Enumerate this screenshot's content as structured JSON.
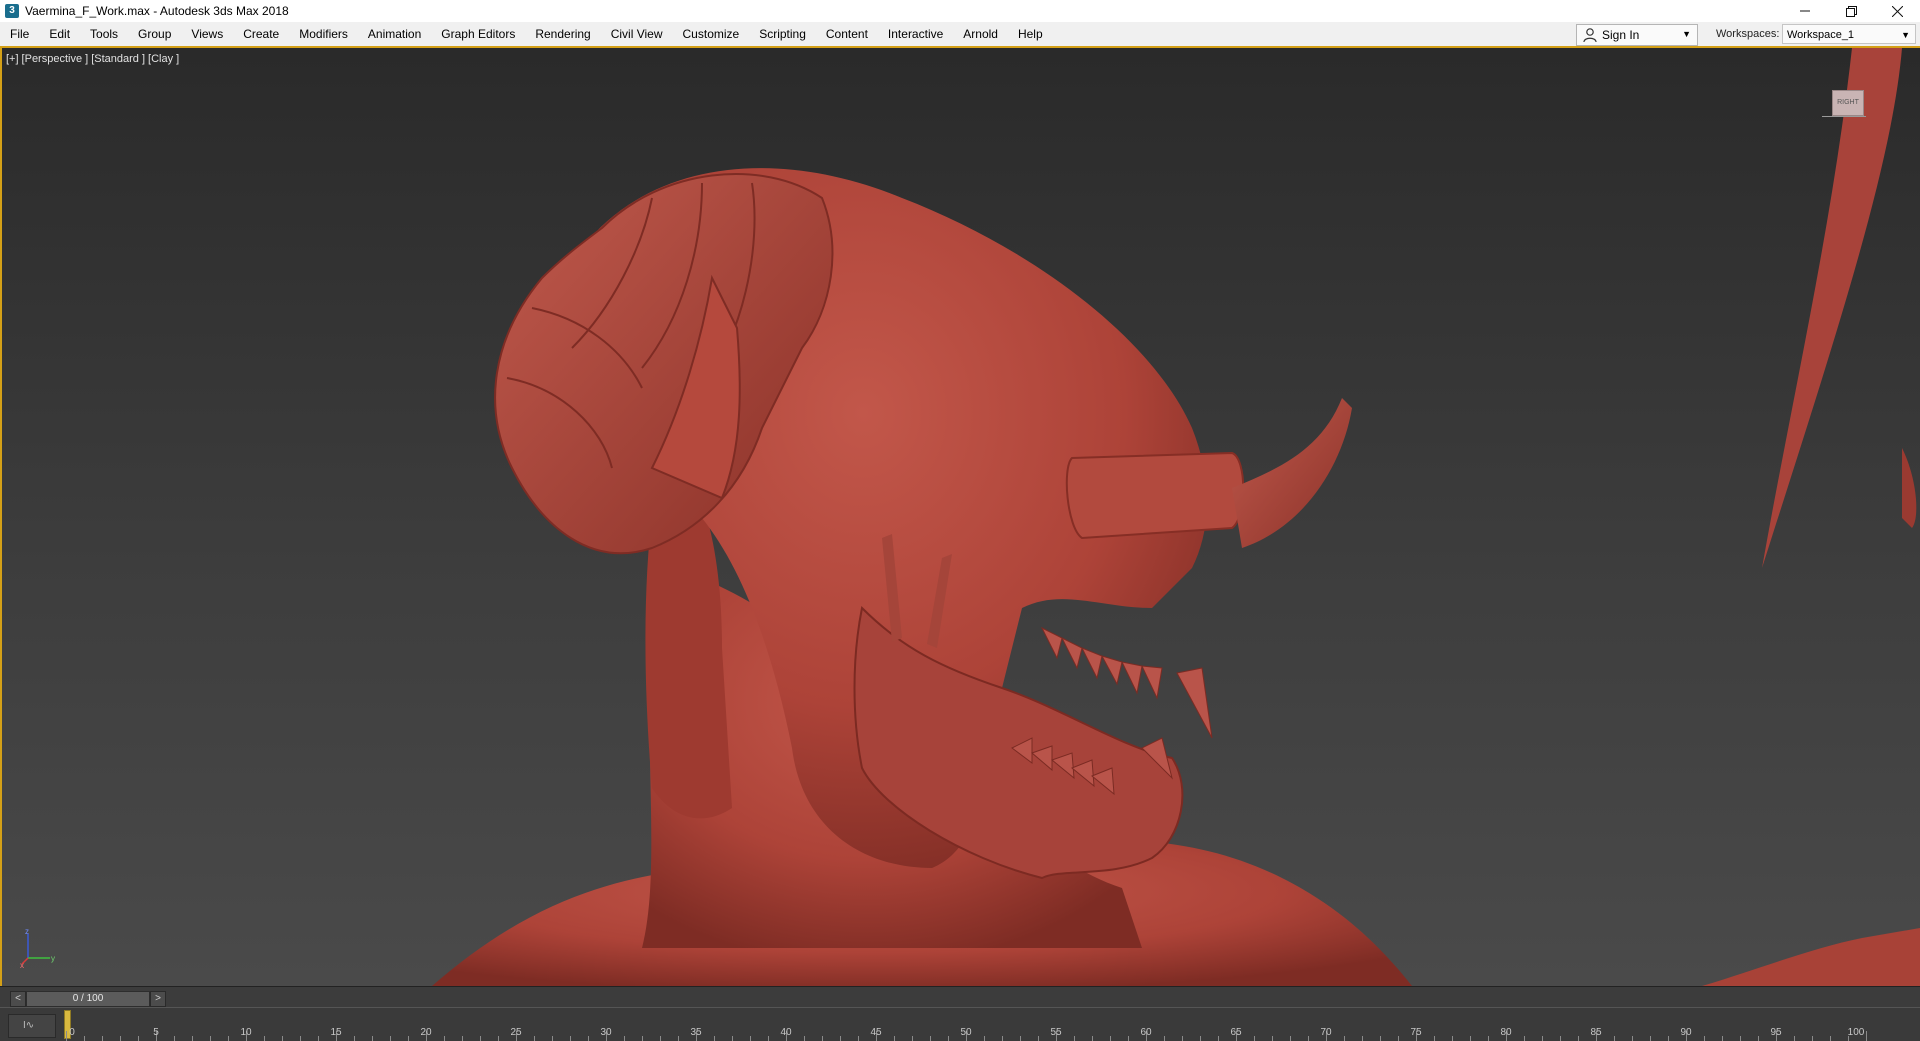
{
  "window": {
    "icon_letter": "3",
    "title": "Vaermina_F_Work.max - Autodesk 3ds Max 2018",
    "controls": [
      "minimize-icon",
      "restore-icon",
      "close-icon"
    ]
  },
  "menu": [
    "File",
    "Edit",
    "Tools",
    "Group",
    "Views",
    "Create",
    "Modifiers",
    "Animation",
    "Graph Editors",
    "Rendering",
    "Civil View",
    "Customize",
    "Scripting",
    "Content",
    "Interactive",
    "Arnold",
    "Help"
  ],
  "signin": {
    "label": "Sign In"
  },
  "workspaces": {
    "label": "Workspaces:",
    "value": "Workspace_1"
  },
  "viewport": {
    "labels": [
      "[+]",
      "[Perspective ]",
      "[Standard ]",
      "[Clay ]"
    ],
    "viewcube_label": "RIGHT",
    "axis": {
      "x": "x",
      "y": "y",
      "z": "z"
    },
    "colors": {
      "clay": "#b4483c",
      "active_border": "#d4a017"
    }
  },
  "timeline": {
    "prev": "<",
    "next": ">",
    "frame_readout": "0 / 100",
    "current_frame": 0,
    "total_frames": 100,
    "tick_labels": [
      "0",
      "5",
      "10",
      "15",
      "20",
      "25",
      "30",
      "35",
      "40",
      "45",
      "50",
      "55",
      "60",
      "65",
      "70",
      "75",
      "80",
      "85",
      "90",
      "95",
      "100"
    ]
  },
  "trackbar_icon": {
    "text": "I∿"
  }
}
